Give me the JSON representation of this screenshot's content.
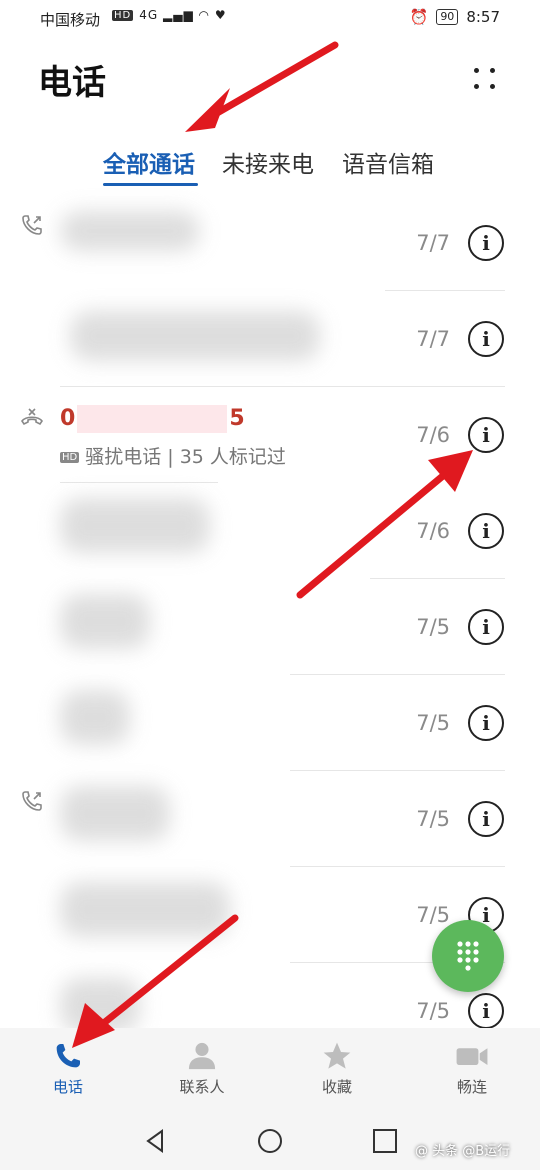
{
  "status_bar": {
    "carrier": "中国移动",
    "hd": "HD",
    "signal": "4G",
    "battery": "90",
    "time": "8:57"
  },
  "header": {
    "title": "电话"
  },
  "tabs": [
    {
      "label": "全部通话",
      "active": true
    },
    {
      "label": "未接来电",
      "active": false
    },
    {
      "label": "语音信箱",
      "active": false
    }
  ],
  "calls": [
    {
      "date": "7/7",
      "icon": "outgoing-call-icon"
    },
    {
      "date": "7/7"
    },
    {
      "date": "7/6",
      "icon": "rejected-call-icon",
      "number_start": "0",
      "number_end": "5",
      "hd": "HD",
      "label": "骚扰电话 | 35 人标记过"
    },
    {
      "date": "7/6"
    },
    {
      "date": "7/5"
    },
    {
      "date": "7/5"
    },
    {
      "date": "7/5",
      "icon": "outgoing-call-icon"
    },
    {
      "date": "7/5"
    },
    {
      "date": "7/5"
    }
  ],
  "info_glyph": "i",
  "bottom_nav": [
    {
      "label": "电话",
      "icon": "phone-icon",
      "active": true
    },
    {
      "label": "联系人",
      "icon": "contacts-icon",
      "active": false
    },
    {
      "label": "收藏",
      "icon": "star-icon",
      "active": false
    },
    {
      "label": "畅连",
      "icon": "video-call-icon",
      "active": false
    }
  ],
  "watermark": "@ 头条 @B运行",
  "colors": {
    "accent": "#1a5fb4",
    "spam_red": "#c0392b",
    "fab_green": "#5cb85c",
    "arrow_red": "#e0191f"
  }
}
